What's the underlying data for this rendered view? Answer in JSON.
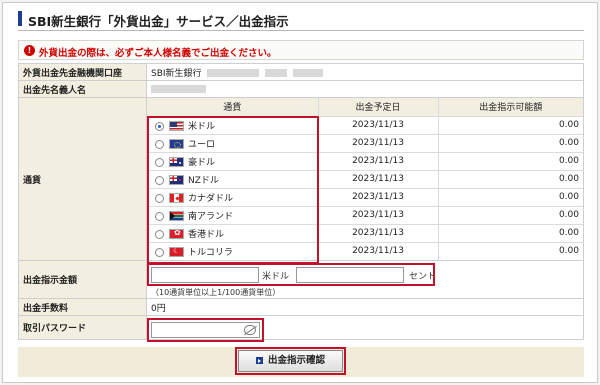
{
  "page": {
    "title": "SBI新生銀行「外貨出金」サービス／出金指示"
  },
  "notice": {
    "icon": "warning-icon",
    "icon_char": "!",
    "text": "外貨出金の際は、必ずご本人様名義でご出金ください。"
  },
  "form": {
    "bank_label": "外貨出金先金融機関口座",
    "bank_value": "SBI新生銀行",
    "name_label": "出金先名義人名",
    "currency_label": "通貨",
    "amount_label": "出金指示金額",
    "fee_label": "出金手数料",
    "fee_value": "0円",
    "password_label": "取引パスワード"
  },
  "currency_table": {
    "headers": [
      "通貨",
      "出金予定日",
      "出金指示可能額"
    ],
    "rows": [
      {
        "name": "米ドル",
        "flag": "flag-us",
        "date": "2023/11/13",
        "available": "0.00",
        "selected": true
      },
      {
        "name": "ユーロ",
        "flag": "flag-eu",
        "date": "2023/11/13",
        "available": "0.00",
        "selected": false
      },
      {
        "name": "豪ドル",
        "flag": "flag-au",
        "date": "2023/11/13",
        "available": "0.00",
        "selected": false
      },
      {
        "name": "NZドル",
        "flag": "flag-nz",
        "date": "2023/11/13",
        "available": "0.00",
        "selected": false
      },
      {
        "name": "カナダドル",
        "flag": "flag-ca",
        "date": "2023/11/13",
        "available": "0.00",
        "selected": false
      },
      {
        "name": "南アランド",
        "flag": "flag-za",
        "date": "2023/11/13",
        "available": "0.00",
        "selected": false
      },
      {
        "name": "香港ドル",
        "flag": "flag-hk",
        "date": "2023/11/13",
        "available": "0.00",
        "selected": false
      },
      {
        "name": "トルコリラ",
        "flag": "flag-tr",
        "date": "2023/11/13",
        "available": "0.00",
        "selected": false
      }
    ]
  },
  "amount": {
    "major_value": "",
    "major_unit": "米ドル",
    "minor_value": "",
    "minor_unit": "セント",
    "hint": "（10通貨単位以上1/100通貨単位）"
  },
  "password": {
    "value": "",
    "toggle_icon": "eye-slash-icon"
  },
  "confirm_button": {
    "label": "出金指示確認",
    "icon": "arrow-right-icon"
  },
  "colors": {
    "highlight": "#c3102c",
    "label_bg": "#f3efe0",
    "notice_red": "#d10000",
    "title_bar": "#1b3f8f"
  }
}
